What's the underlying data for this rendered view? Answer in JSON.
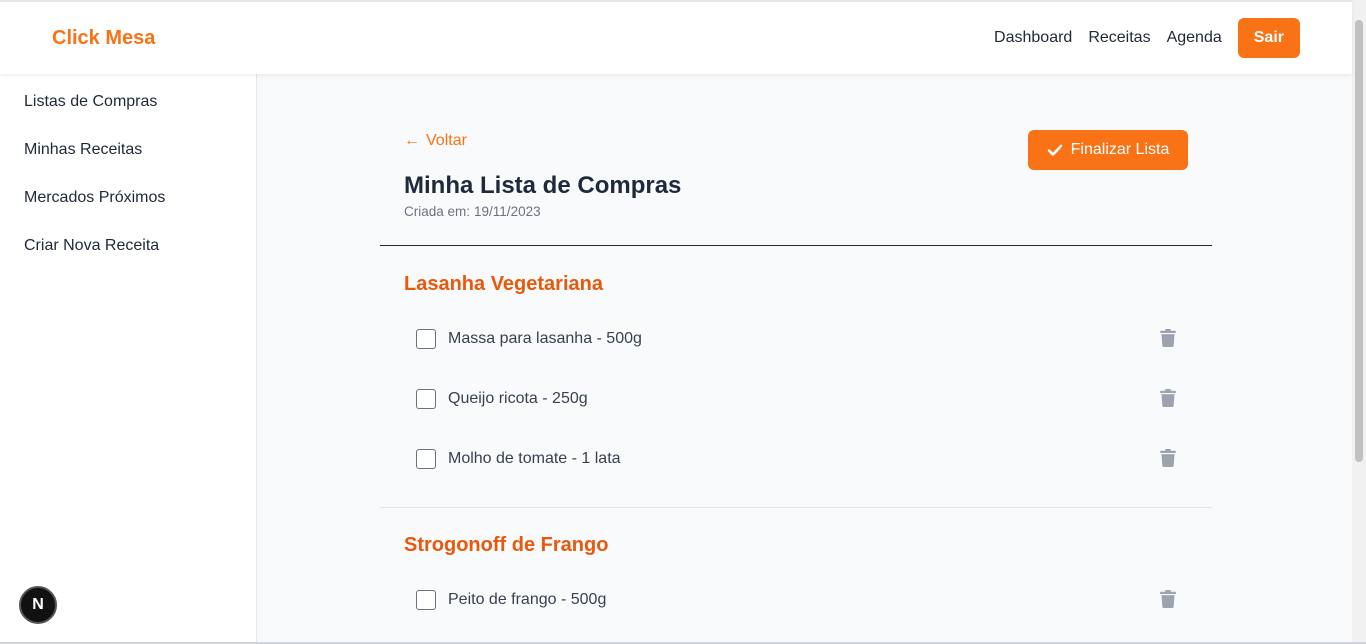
{
  "header": {
    "brand": "Click Mesa",
    "nav": [
      "Dashboard",
      "Receitas",
      "Agenda"
    ],
    "logout_label": "Sair"
  },
  "sidebar": {
    "items": [
      {
        "label": "Listas de Compras"
      },
      {
        "label": "Minhas Receitas"
      },
      {
        "label": "Mercados Próximos"
      },
      {
        "label": "Criar Nova Receita"
      }
    ]
  },
  "main": {
    "back_label": "Voltar",
    "title": "Minha Lista de Compras",
    "created_label": "Criada em:",
    "created_date": "19/11/2023",
    "finalize_label": "Finalizar Lista",
    "sections": [
      {
        "recipe": "Lasanha Vegetariana",
        "items": [
          {
            "label": "Massa para lasanha - 500g",
            "checked": false
          },
          {
            "label": "Queijo ricota - 250g",
            "checked": false
          },
          {
            "label": "Molho de tomate - 1 lata",
            "checked": false
          }
        ]
      },
      {
        "recipe": "Strogonoff de Frango",
        "items": [
          {
            "label": "Peito de frango - 500g",
            "checked": false
          }
        ]
      }
    ]
  },
  "badge": "N",
  "colors": {
    "accent": "#f97316",
    "recipe_title": "#ea580c",
    "icon_gray": "#9ca3af"
  }
}
